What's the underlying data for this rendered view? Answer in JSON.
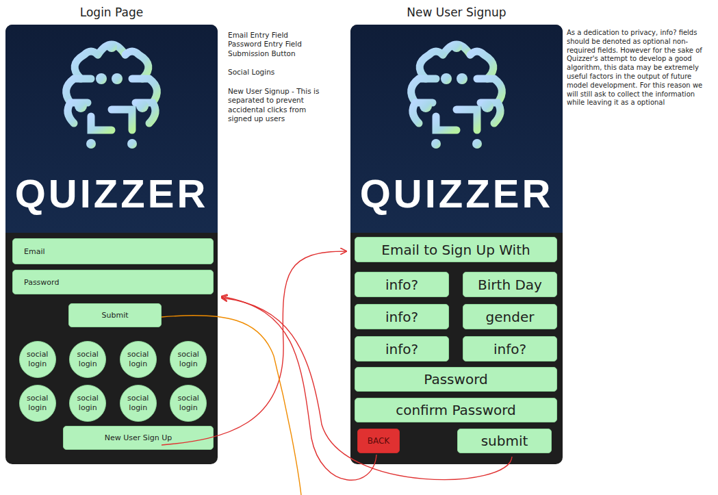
{
  "login": {
    "title": "Login Page",
    "brand": "QUIZZER",
    "fields": [
      {
        "placeholder": "Email"
      },
      {
        "placeholder": "Password"
      }
    ],
    "submit": "Submit",
    "social_logins": [
      "social login",
      "social login",
      "social login",
      "social login",
      "social login",
      "social login",
      "social login",
      "social login"
    ],
    "signup_button": "New User Sign Up",
    "notes": [
      [
        "Email Entry Field",
        "Password Entry Field",
        "Submission Button"
      ],
      [
        "Social Logins"
      ],
      [
        "New User Signup - This is separated to prevent accidental clicks from signed up users"
      ]
    ]
  },
  "signup": {
    "title": "New User Signup",
    "brand": "QUIZZER",
    "email_field": "Email to Sign Up With",
    "fields": [
      {
        "label": "info?"
      },
      {
        "label": "Birth Day"
      },
      {
        "label": "info?"
      },
      {
        "label": "gender"
      },
      {
        "label": "info?"
      },
      {
        "label": "info?"
      }
    ],
    "password": "Password",
    "confirm": "confirm Password",
    "buttons": [
      {
        "label": "BACK",
        "kind": "back"
      },
      {
        "label": "submit",
        "kind": "submit"
      }
    ],
    "note": "As a dedication to privacy, info? fields should be denoted as optional non-required fields. However for the sake of Quizzer's attempt to develop a good algorithm, this data may be extremely useful factors in the output of future model development. For this reason we will still ask to collect the information while leaving it as a optional"
  },
  "connectors": [
    {
      "color": "#e03131"
    },
    {
      "color": "#e03131"
    },
    {
      "color": "#e03131"
    },
    {
      "color": "#f08c00"
    }
  ]
}
